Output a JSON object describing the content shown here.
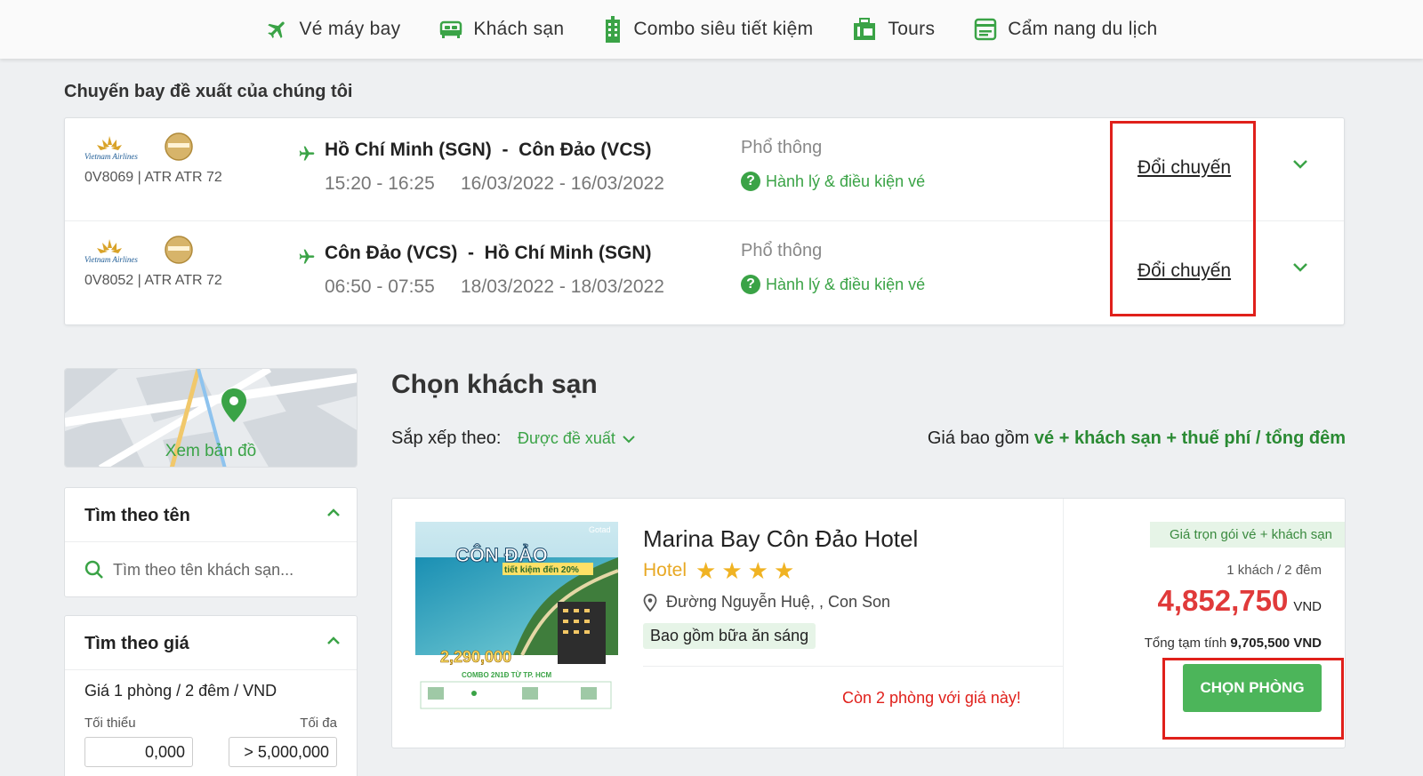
{
  "nav": {
    "items": [
      {
        "label": "Vé máy bay",
        "icon": "plane-icon"
      },
      {
        "label": "Khách sạn",
        "icon": "bed-icon"
      },
      {
        "label": "Combo siêu tiết kiệm",
        "icon": "building-icon"
      },
      {
        "label": "Tours",
        "icon": "luggage-icon"
      },
      {
        "label": "Cẩm nang du lịch",
        "icon": "guide-icon"
      }
    ]
  },
  "flights": {
    "title": "Chuyến bay đề xuất của chúng tôi",
    "rows": [
      {
        "airline": "Vietnam Airlines",
        "code": "0V8069 | ATR ATR 72",
        "route_from": "Hồ Chí Minh (SGN)",
        "route_sep": "-",
        "route_to": "Côn Đảo (VCS)",
        "times": "15:20 - 16:25",
        "dates": "16/03/2022 - 16/03/2022",
        "cabin": "Phổ thông",
        "baggage": "Hành lý & điều kiện vé",
        "change": "Đổi chuyến"
      },
      {
        "airline": "Vietnam Airlines",
        "code": "0V8052 | ATR ATR 72",
        "route_from": "Côn Đảo (VCS)",
        "route_sep": "-",
        "route_to": "Hồ Chí Minh (SGN)",
        "times": "06:50 - 07:55",
        "dates": "18/03/2022 - 18/03/2022",
        "cabin": "Phổ thông",
        "baggage": "Hành lý & điều kiện vé",
        "change": "Đổi chuyến"
      }
    ]
  },
  "map": {
    "label": "Xem bản đồ"
  },
  "filters": {
    "name": {
      "title": "Tìm theo tên",
      "placeholder": "Tìm theo tên khách sạn..."
    },
    "price": {
      "title": "Tìm theo giá",
      "subtitle": "Giá 1 phòng / 2 đêm / VND",
      "min_label": "Tối thiểu",
      "max_label": "Tối đa",
      "min_value": "0,000",
      "max_value": "> 5,000,000"
    }
  },
  "hotels": {
    "title": "Chọn khách sạn",
    "sort_label": "Sắp xếp theo:",
    "sort_value": "Được đề xuất",
    "price_note_prefix": "Giá bao gồm",
    "price_note_bold": "vé + khách sạn + thuế phí / tổng đêm",
    "card": {
      "name": "Marina Bay Côn Đảo Hotel",
      "type": "Hotel",
      "stars": 4,
      "address": "Đường Nguyễn Huệ, , Con Son",
      "breakfast": "Bao gồm bữa ăn sáng",
      "rooms_left": "Còn 2 phòng với giá này!",
      "badge": "Giá trọn gói vé + khách sạn",
      "guests": "1 khách / 2 đêm",
      "price": "4,852,750",
      "currency": "VND",
      "total_label": "Tổng tạm tính",
      "total_value": "9,705,500 VND",
      "button": "CHỌN PHÒNG",
      "image_text": {
        "brand": "Gotad",
        "headline": "CÔN ĐẢO",
        "sub": "tiết kiệm đến 20%",
        "price": "2,290,000",
        "combo": "COMBO 2N1Đ TỪ TP. HCM"
      }
    }
  },
  "colors": {
    "accent": "#3aa346",
    "price": "#e03a3a",
    "highlight": "#e0201b",
    "star": "#f0b323"
  }
}
